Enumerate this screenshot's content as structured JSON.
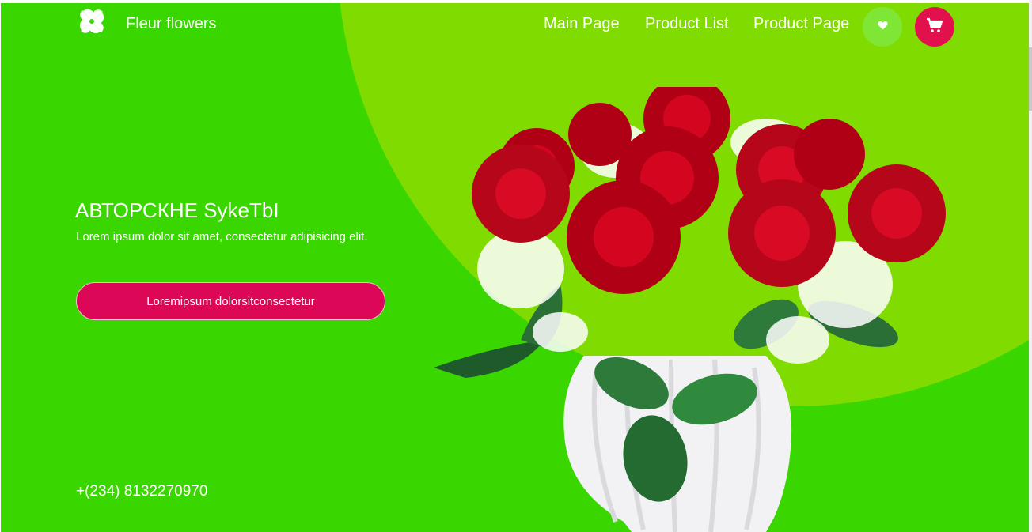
{
  "header": {
    "brand": "Fleur flowers",
    "logo_icon": "pinwheel-logo-icon",
    "nav": [
      {
        "label": "Main Page"
      },
      {
        "label": "Product List"
      },
      {
        "label": "Product Page"
      }
    ],
    "wishlist_icon": "heart-icon",
    "cart_icon": "shopping-cart-icon"
  },
  "hero": {
    "title": "АВТОРСКНЕ SykeTbI",
    "subtitle": "Lorem ipsum dolor sit amet, consectetur adipisicing elit.",
    "cta_label": "Loremipsum dolorsitconsectetur",
    "phone": "+(234) 8132270970",
    "image": "red-roses-bouquet-in-white-vase"
  },
  "colors": {
    "background": "#39d600",
    "accent_circle": "#80dc00",
    "cta": "#dc0756",
    "cart_button": "#e3104e",
    "wishlist_button": "#80e636",
    "text": "#ffffff"
  }
}
